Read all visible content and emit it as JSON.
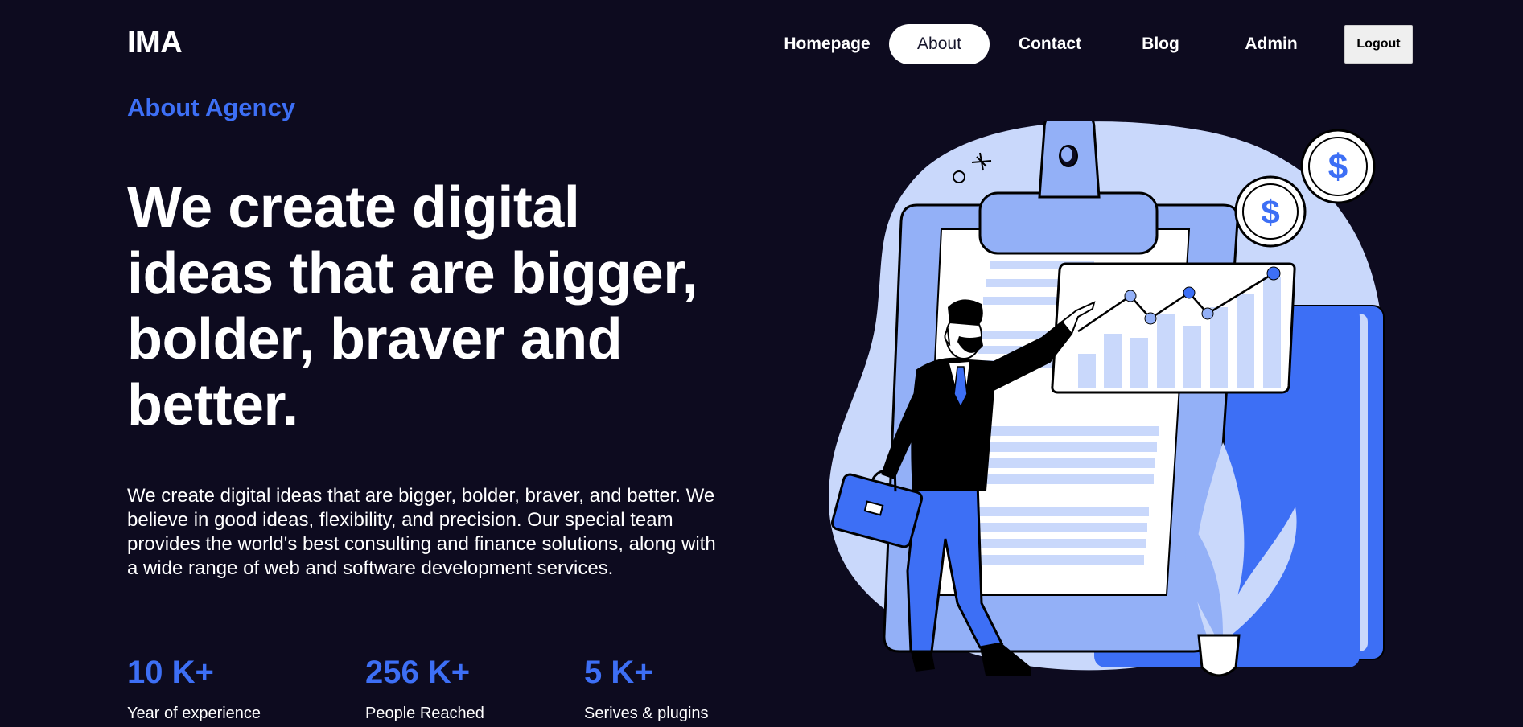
{
  "header": {
    "logo": "IMA",
    "nav": {
      "homepage": "Homepage",
      "about": "About",
      "contact": "Contact",
      "blog": "Blog",
      "admin": "Admin"
    },
    "logout_label": "Logout"
  },
  "hero": {
    "eyebrow": "About Agency",
    "headline": "We create digital ideas that are bigger, bolder, braver and better.",
    "description": "We create digital ideas that are bigger, bolder, braver, and better. We believe in good ideas, flexibility, and precision. Our special team provides the world's best consulting and finance solutions, along with a wide range of web and software development services."
  },
  "stats": [
    {
      "value": "10 K+",
      "label": "Year of experience"
    },
    {
      "value": "256 K+",
      "label": "People Reached"
    },
    {
      "value": "5 K+",
      "label": "Serives & plugins"
    }
  ],
  "illustration": {
    "icon": "businessman-presenting-chart-illustration",
    "coin_symbol": "$",
    "colors": {
      "accent": "#3d6ff5",
      "light_blue": "#c9d8fb",
      "mid_blue": "#93b0f7",
      "background": "#0d0b1f"
    }
  }
}
